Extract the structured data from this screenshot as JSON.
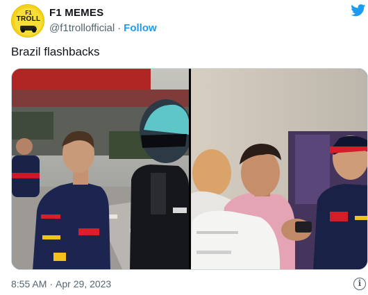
{
  "author": {
    "name": "F1 MEMES",
    "handle": "@f1trollofficial",
    "follow_label": "Follow",
    "avatar": {
      "top_text": "F1",
      "bottom_text": "TROLL"
    }
  },
  "separator": "·",
  "tweet": {
    "text": "Brazil flashbacks",
    "time": "8:55 AM",
    "date": "Apr 29, 2023"
  },
  "media": {
    "photo_left_icon": "f1-drivers-photo",
    "photo_right_icon": "f1-drivers-photo"
  },
  "icons": {
    "brand": "twitter-bird-icon",
    "info": "info-icon"
  },
  "colors": {
    "accent": "#1d9bf0",
    "secondary_text": "#536471",
    "avatar_bg": "#f2d21c"
  }
}
